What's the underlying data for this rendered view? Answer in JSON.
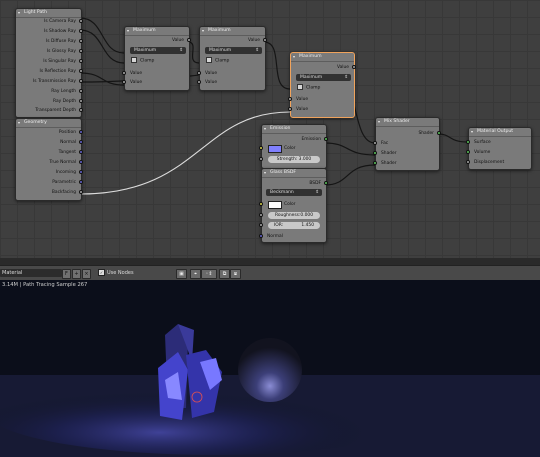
{
  "light_path": {
    "title": "Light Path",
    "outputs": [
      "Is Camera Ray",
      "Is Shadow Ray",
      "Is Diffuse Ray",
      "Is Glossy Ray",
      "Is Singular Ray",
      "Is Reflection Ray",
      "Is Transmission Ray",
      "Ray Length",
      "Ray Depth",
      "Transparent Depth"
    ]
  },
  "geometry": {
    "title": "Geometry",
    "outputs": [
      "Position",
      "Normal",
      "Tangent",
      "True Normal",
      "Incoming",
      "Parametric",
      "Backfacing"
    ]
  },
  "math1": {
    "title": "Maximum",
    "output": "Value",
    "operation": "Maximum",
    "clamp": "Clamp",
    "inputs": [
      "Value",
      "Value"
    ]
  },
  "math2": {
    "title": "Maximum",
    "output": "Value",
    "operation": "Maximum",
    "clamp": "Clamp",
    "inputs": [
      "Value",
      "Value"
    ]
  },
  "math3": {
    "title": "Maximum",
    "output": "Value",
    "operation": "Maximum",
    "clamp": "Clamp",
    "inputs": [
      "Value",
      "Value"
    ]
  },
  "emission": {
    "title": "Emission",
    "output": "Emission",
    "color_label": "Color",
    "color": "#8080ff",
    "strength": "Strength: 3.000"
  },
  "glass": {
    "title": "Glass BSDF",
    "output": "BSDF",
    "distribution": "Beckmann",
    "color_label": "Color",
    "color": "#ffffff",
    "roughness": "Roughness:0.000",
    "ior_label": "IOR:",
    "ior_value": "1.450",
    "normal": "Normal"
  },
  "mix": {
    "title": "Mix Shader",
    "output": "Shader",
    "inputs": [
      "Fac",
      "Shader",
      "Shader"
    ]
  },
  "material_output": {
    "title": "Material Output",
    "inputs": [
      "Surface",
      "Volume",
      "Displacement"
    ]
  },
  "header": {
    "material_name": "Material",
    "f_label": "F",
    "use_nodes": "Use Nodes"
  },
  "render": {
    "info": "3.14M | Path Tracing Sample 267"
  },
  "colors": {
    "socket_float": "#aaaaaa",
    "socket_shader": "#5bc55b",
    "socket_color": "#d8d34e",
    "socket_vector": "#6666d0",
    "active_border": "#f0a35c"
  }
}
